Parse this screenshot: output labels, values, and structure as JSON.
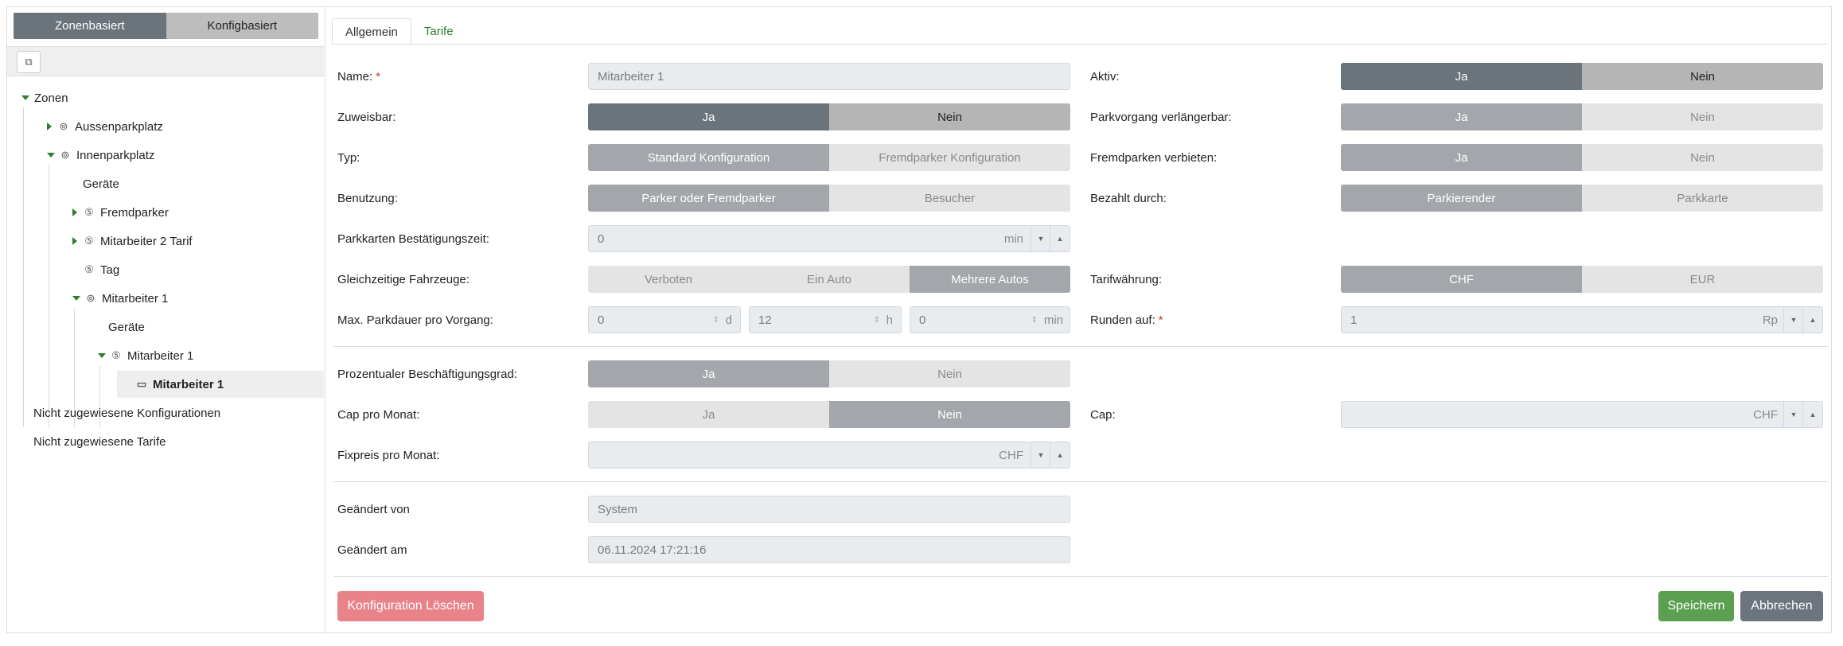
{
  "sidebar": {
    "mode_tabs": [
      "Zonenbasiert",
      "Konfigbasiert"
    ],
    "tree": {
      "root": "Zonen",
      "aussen": "Aussenparkplatz",
      "innen": "Innenparkplatz",
      "geraete1": "Geräte",
      "fremdparker": "Fremdparker",
      "mitarbeiter2": "Mitarbeiter 2 Tarif",
      "tag": "Tag",
      "mitarbeiter1_zone": "Mitarbeiter 1",
      "geraete2": "Geräte",
      "mitarbeiter1_tarif": "Mitarbeiter 1",
      "mitarbeiter1_config": "Mitarbeiter 1",
      "unassigned_configs": "Nicht zugewiesene Konfigurationen",
      "unassigned_tariffs": "Nicht zugewiesene Tarife"
    }
  },
  "tabs": [
    "Allgemein",
    "Tarife"
  ],
  "form": {
    "name_label": "Name:",
    "name_value": "Mitarbeiter 1",
    "aktiv_label": "Aktiv:",
    "zuweisbar_label": "Zuweisbar:",
    "parkvorgang_label": "Parkvorgang verlängerbar:",
    "typ_label": "Typ:",
    "typ_options": [
      "Standard Konfiguration",
      "Fremdparker Konfiguration"
    ],
    "fremdparken_label": "Fremdparken verbieten:",
    "benutzung_label": "Benutzung:",
    "benutzung_options": [
      "Parker oder Fremdparker",
      "Besucher"
    ],
    "bezahlt_label": "Bezahlt durch:",
    "bezahlt_options": [
      "Parkierender",
      "Parkkarte"
    ],
    "bestaetigung_label": "Parkkarten Bestätigungszeit:",
    "bestaetigung_value": "0",
    "bestaetigung_unit": "min",
    "fahrzeuge_label": "Gleichzeitige Fahrzeuge:",
    "fahrzeuge_options": [
      "Verboten",
      "Ein Auto",
      "Mehrere Autos"
    ],
    "waehrung_label": "Tarifwährung:",
    "waehrung_options": [
      "CHF",
      "EUR"
    ],
    "parkdauer_label": "Max. Parkdauer pro Vorgang:",
    "parkdauer_d": "0",
    "parkdauer_d_unit": "d",
    "parkdauer_h": "12",
    "parkdauer_h_unit": "h",
    "parkdauer_min": "0",
    "parkdauer_min_unit": "min",
    "runden_label": "Runden auf:",
    "runden_value": "1",
    "runden_unit": "Rp",
    "prozent_label": "Prozentualer Beschäftigungsgrad:",
    "cap_monat_label": "Cap pro Monat:",
    "cap_label": "Cap:",
    "cap_unit": "CHF",
    "fixpreis_label": "Fixpreis pro Monat:",
    "fixpreis_unit": "CHF",
    "geaendert_von_label": "Geändert von",
    "geaendert_von_value": "System",
    "geaendert_am_label": "Geändert am",
    "geaendert_am_value": "06.11.2024 17:21:16",
    "ja": "Ja",
    "nein": "Nein",
    "required_mark": "*"
  },
  "buttons": {
    "delete": "Konfiguration Löschen",
    "save": "Speichern",
    "cancel": "Abbrechen"
  },
  "colors": {
    "active_segment": "#6b737b",
    "success": "#5aa050",
    "danger": "#e8838a",
    "secondary": "#6c757d",
    "tree_accent": "#2e7d32"
  }
}
